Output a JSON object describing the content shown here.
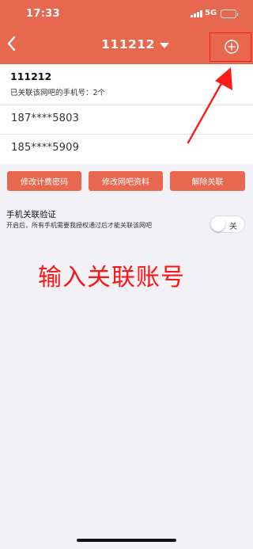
{
  "status_bar": {
    "time": "17:33",
    "network": "5G",
    "icons": [
      "signal-icon",
      "battery-icon"
    ]
  },
  "header": {
    "title": "111212",
    "back_icon": "chevron-left-icon",
    "title_icon": "caret-down-icon",
    "add_icon": "plus-circle-icon",
    "color": "#e8674f"
  },
  "cafe": {
    "name": "111212",
    "linked_count_text": "已关联该网吧的手机号：2个"
  },
  "phones": [
    "187****5803",
    "185****5909"
  ],
  "actions": [
    "修改计费密码",
    "修改网吧资料",
    "解除关联"
  ],
  "verification": {
    "title": "手机关联验证",
    "description": "开启后，所有手机需要我授权通过后才能关联该网吧",
    "toggle_label": "关",
    "enabled": false
  },
  "annotation": {
    "text": "输入关联账号",
    "color": "#ff1515"
  }
}
